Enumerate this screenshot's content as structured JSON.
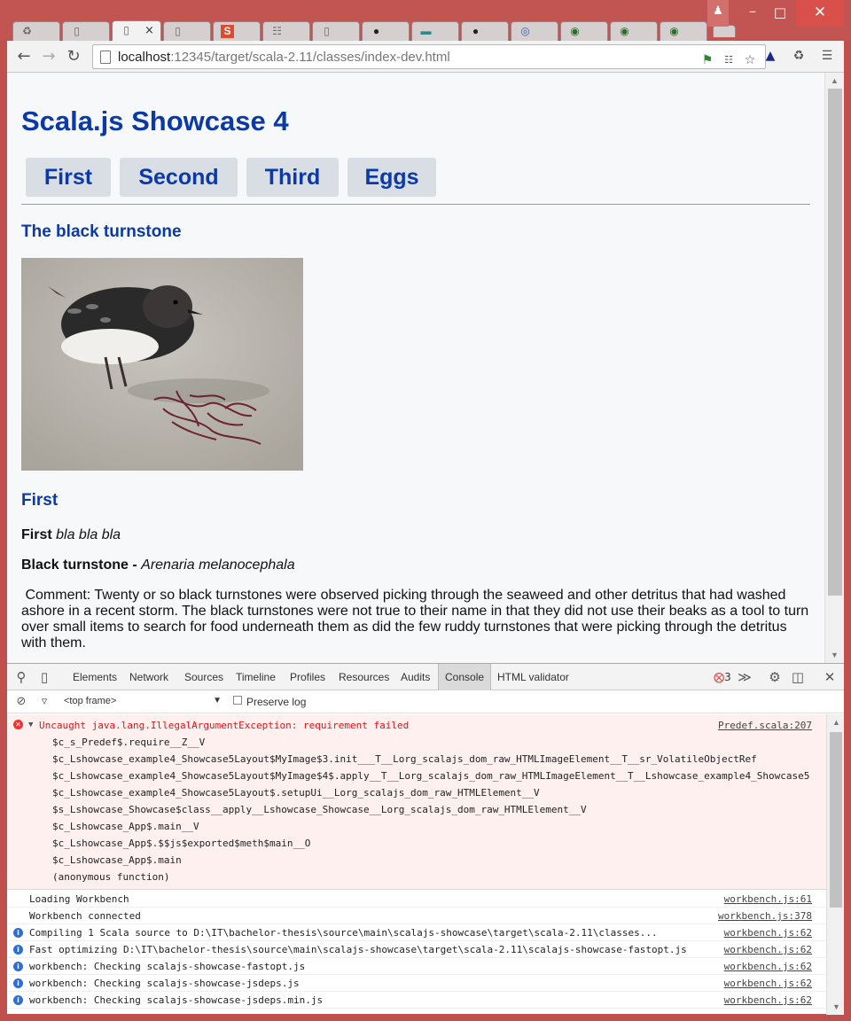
{
  "browser": {
    "tabs": [
      {
        "icon": "recycle-icon"
      },
      {
        "icon": "page-icon"
      },
      {
        "icon": "page-icon",
        "active": true
      },
      {
        "icon": "page-icon"
      },
      {
        "icon": "s-icon"
      },
      {
        "icon": "book-icon"
      },
      {
        "icon": "page-icon"
      },
      {
        "icon": "github-icon"
      },
      {
        "icon": "car-icon"
      },
      {
        "icon": "github-icon"
      },
      {
        "icon": "target-icon"
      },
      {
        "icon": "wiki-icon"
      },
      {
        "icon": "wiki-icon"
      },
      {
        "icon": "wiki-icon"
      }
    ],
    "url_host": "localhost",
    "url_path": ":12345/target/scala-2.11/classes/index-dev.html",
    "colors": {
      "frame": "#c25552",
      "accent": "#0b3aa8"
    }
  },
  "page": {
    "title": "Scala.js Showcase 4",
    "nav": [
      "First",
      "Second",
      "Third",
      "Eggs"
    ],
    "section_title": "The black turnstone",
    "sub_title": "First",
    "p1_bold": "First",
    "p1_italic": "bla bla bla",
    "p2_bold": "Black turnstone -",
    "p2_italic": "Arenaria melanocephala",
    "comment": "Comment: Twenty or so black turnstones were observed picking through the seaweed and other detritus that had washed ashore in a recent storm. The black turnstones were not true to their name in that they did not use their beaks as a tool to turn over small items to search for food underneath them as did the few ruddy turnstones that were picking through the detritus with them."
  },
  "devtools": {
    "tabs": [
      "Elements",
      "Network",
      "Sources",
      "Timeline",
      "Profiles",
      "Resources",
      "Audits",
      "Console",
      "HTML validator"
    ],
    "selected_tab": "Console",
    "error_count": "3",
    "frame_select": "<top frame>",
    "preserve_log": "Preserve log",
    "error": {
      "message": "Uncaught java.lang.IllegalArgumentException: requirement failed",
      "source": "Predef.scala:207",
      "stack": [
        "$c_s_Predef$.require__Z__V",
        "$c_Lshowcase_example4_Showcase5Layout$MyImage$3.init___T__Lorg_scalajs_dom_raw_HTMLImageElement__T__sr_VolatileObjectRef",
        "$c_Lshowcase_example4_Showcase5Layout$MyImage$4$.apply__T__Lorg_scalajs_dom_raw_HTMLImageElement__T__Lshowcase_example4_Showcase5",
        "$c_Lshowcase_example4_Showcase5Layout$.setupUi__Lorg_scalajs_dom_raw_HTMLElement__V",
        "$s_Lshowcase_Showcase$class__apply__Lshowcase_Showcase__Lorg_scalajs_dom_raw_HTMLElement__V",
        "$c_Lshowcase_App$.main__V",
        "$c_Lshowcase_App$.$$js$exported$meth$main__O",
        "$c_Lshowcase_App$.main",
        "(anonymous function)"
      ]
    },
    "logs": [
      {
        "msg": "Loading Workbench",
        "src": "workbench.js:61",
        "info": false
      },
      {
        "msg": "Workbench connected",
        "src": "workbench.js:378",
        "info": false
      },
      {
        "msg": "Compiling 1 Scala source to D:\\IT\\bachelor-thesis\\source\\main\\scalajs-showcase\\target\\scala-2.11\\classes...",
        "src": "workbench.js:62",
        "info": true
      },
      {
        "msg": "Fast optimizing D:\\IT\\bachelor-thesis\\source\\main\\scalajs-showcase\\target\\scala-2.11\\scalajs-showcase-fastopt.js",
        "src": "workbench.js:62",
        "info": true
      },
      {
        "msg": "workbench: Checking scalajs-showcase-fastopt.js",
        "src": "workbench.js:62",
        "info": true
      },
      {
        "msg": "workbench: Checking scalajs-showcase-jsdeps.js",
        "src": "workbench.js:62",
        "info": true
      },
      {
        "msg": "workbench: Checking scalajs-showcase-jsdeps.min.js",
        "src": "workbench.js:62",
        "info": true
      }
    ]
  }
}
